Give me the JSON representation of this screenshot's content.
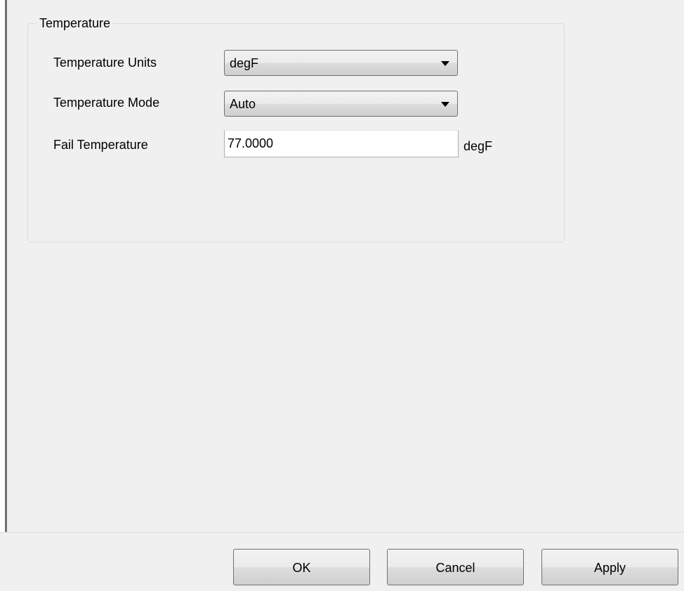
{
  "group": {
    "title": "Temperature"
  },
  "fields": {
    "units_label": "Temperature Units",
    "units_value": "degF",
    "mode_label": "Temperature Mode",
    "mode_value": "Auto",
    "fail_label": "Fail Temperature",
    "fail_value": "77.0000",
    "fail_unit": "degF"
  },
  "buttons": {
    "ok": "OK",
    "cancel": "Cancel",
    "apply": "Apply"
  },
  "icons": {
    "dropdown": "chevron-down-icon"
  }
}
